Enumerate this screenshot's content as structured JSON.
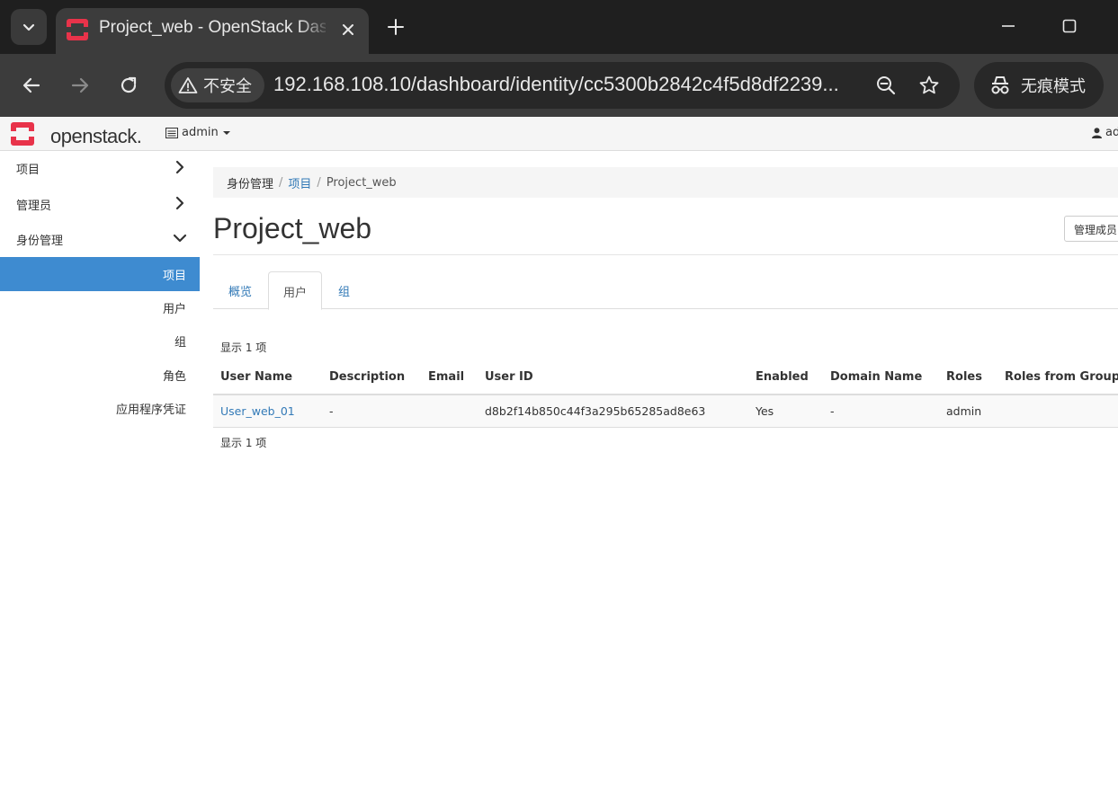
{
  "browser": {
    "tab_title": "Project_web - OpenStack Dashboard",
    "security_label": "不安全",
    "url": "192.168.108.10/dashboard/identity/cc5300b2842c4f5d8df2239...",
    "incognito_label": "无痕模式",
    "accent_color": "#e8334a"
  },
  "navbar": {
    "logo_text": "openstack.",
    "project_selector": "admin",
    "user_menu": "ad"
  },
  "sidebar": {
    "sections": [
      {
        "label": "项目"
      },
      {
        "label": "管理员"
      },
      {
        "label": "身份管理"
      }
    ],
    "items": [
      {
        "label": "项目",
        "active": true
      },
      {
        "label": "用户",
        "active": false
      },
      {
        "label": "组",
        "active": false
      },
      {
        "label": "角色",
        "active": false
      },
      {
        "label": "应用程序凭证",
        "active": false
      }
    ]
  },
  "breadcrumb": {
    "root": "身份管理",
    "sep": "/",
    "parent": "项目",
    "current": "Project_web"
  },
  "page": {
    "title": "Project_web",
    "manage_button": "管理成员"
  },
  "tabs": [
    {
      "label": "概览",
      "active": false
    },
    {
      "label": "用户",
      "active": true
    },
    {
      "label": "组",
      "active": false
    }
  ],
  "table": {
    "count_text": "显示 1 项",
    "columns": [
      "User Name",
      "Description",
      "Email",
      "User ID",
      "Enabled",
      "Domain Name",
      "Roles",
      "Roles from Groups"
    ],
    "rows": [
      {
        "user_name": "User_web_01",
        "description": "-",
        "email": "",
        "user_id": "d8b2f14b850c44f3a295b65285ad8e63",
        "enabled": "Yes",
        "domain_name": "-",
        "roles": "admin",
        "roles_from_groups": ""
      }
    ]
  }
}
